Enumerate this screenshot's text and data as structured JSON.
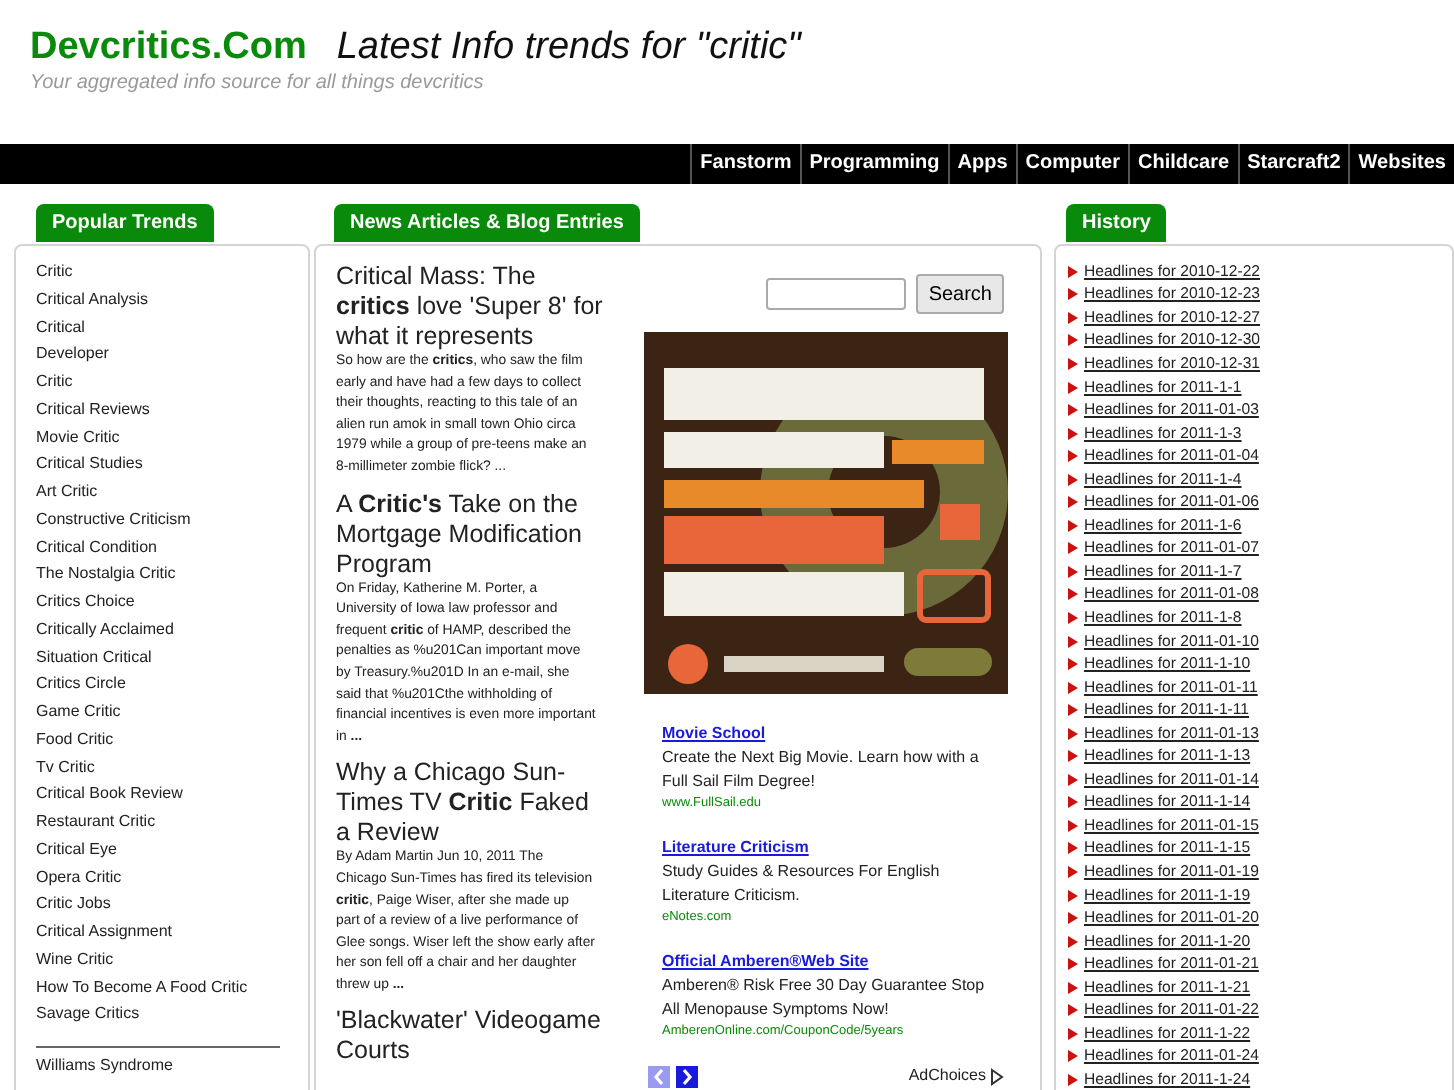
{
  "site": {
    "name": "Devcritics.Com",
    "headline": "Latest Info trends for \"critic\"",
    "tagline": "Your aggregated info source for all things devcritics"
  },
  "nav": [
    "Fanstorm",
    "Programming",
    "Apps",
    "Computer",
    "Childcare",
    "Starcraft2",
    "Websites"
  ],
  "popular_trends": {
    "title": "Popular Trends",
    "items": [
      "Critic",
      "Critical Analysis",
      "Critical",
      "Developer",
      "Critic",
      "Critical Reviews",
      "Movie Critic",
      "Critical Studies",
      "Art Critic",
      "Constructive Criticism",
      "Critical Condition",
      "The Nostalgia Critic",
      "Critics Choice",
      "Critically Acclaimed",
      "Situation Critical",
      "Critics Circle",
      "Game Critic",
      "Food Critic",
      "Tv Critic",
      "Critical Book Review",
      "Restaurant Critic",
      "Critical Eye",
      "Opera Critic",
      "Critic Jobs",
      "Critical Assignment",
      "Wine Critic",
      "How To Become A Food Critic",
      "Savage Critics"
    ],
    "more_items": [
      "Williams Syndrome"
    ]
  },
  "news": {
    "title": "News Articles & Blog Entries",
    "articles": [
      {
        "title": "Critical Mass: The **critics** love 'Super 8' for what it represents",
        "summary": "So how are the **critics**, who saw the film early and have had a few days to collect their thoughts, reacting to this tale of an alien run amok in small town Ohio circa 1979 while a group of pre-teens make an 8-millimeter zombie flick? ..."
      },
      {
        "title": "A **Critic's** Take on the Mortgage Modification Program",
        "summary": "On Friday, Katherine M. Porter, a University of Iowa law professor and frequent **critic** of HAMP, described the penalties as %u201Can important move by Treasury.%u201D In an e-mail, she said that %u201Cthe withholding of financial incentives is even more important in **...**"
      },
      {
        "title": "Why a Chicago Sun-Times TV **Critic** Faked a Review",
        "summary": "By Adam Martin Jun 10, 2011 The Chicago Sun-Times has fired its television **critic**, Paige Wiser, after she made up part of a review of a live performance of Glee songs. Wiser left the show early after her son fell off a chair and her daughter threw up **...**"
      },
      {
        "title": "'Blackwater' Videogame Courts"
      }
    ]
  },
  "search": {
    "button": "Search"
  },
  "text_ads": [
    {
      "title": "Movie School",
      "text": "Create the Next Big Movie. Learn how with a Full Sail Film Degree!",
      "url": "www.FullSail.edu"
    },
    {
      "title": "Literature Criticism",
      "text": "Study Guides & Resources For English Literature Criticism.",
      "url": "eNotes.com"
    },
    {
      "title": "Official Amberen®Web Site",
      "text": "Amberen® Risk Free 30 Day Guarantee Stop All Menopause Symptoms Now!",
      "url": "AmberenOnline.com/CouponCode/5years"
    }
  ],
  "ad_nav": {
    "prev_disabled": true,
    "next_disabled": false
  },
  "ad_choices": "AdChoices",
  "history": {
    "title": "History",
    "items": [
      "Headlines for 2010-12-22",
      "Headlines for 2010-12-23",
      "Headlines for 2010-12-27",
      "Headlines for 2010-12-30",
      "Headlines for 2010-12-31",
      "Headlines for 2011-1-1",
      "Headlines for 2011-01-03",
      "Headlines for 2011-1-3",
      "Headlines for 2011-01-04",
      "Headlines for 2011-1-4",
      "Headlines for 2011-01-06",
      "Headlines for 2011-1-6",
      "Headlines for 2011-01-07",
      "Headlines for 2011-1-7",
      "Headlines for 2011-01-08",
      "Headlines for 2011-1-8",
      "Headlines for 2011-01-10",
      "Headlines for 2011-1-10",
      "Headlines for 2011-01-11",
      "Headlines for 2011-1-11",
      "Headlines for 2011-01-13",
      "Headlines for 2011-1-13",
      "Headlines for 2011-01-14",
      "Headlines for 2011-1-14",
      "Headlines for 2011-01-15",
      "Headlines for 2011-1-15",
      "Headlines for 2011-01-19",
      "Headlines for 2011-1-19",
      "Headlines for 2011-01-20",
      "Headlines for 2011-1-20",
      "Headlines for 2011-01-21",
      "Headlines for 2011-1-21",
      "Headlines for 2011-01-22",
      "Headlines for 2011-1-22",
      "Headlines for 2011-01-24",
      "Headlines for 2011-1-24"
    ]
  }
}
